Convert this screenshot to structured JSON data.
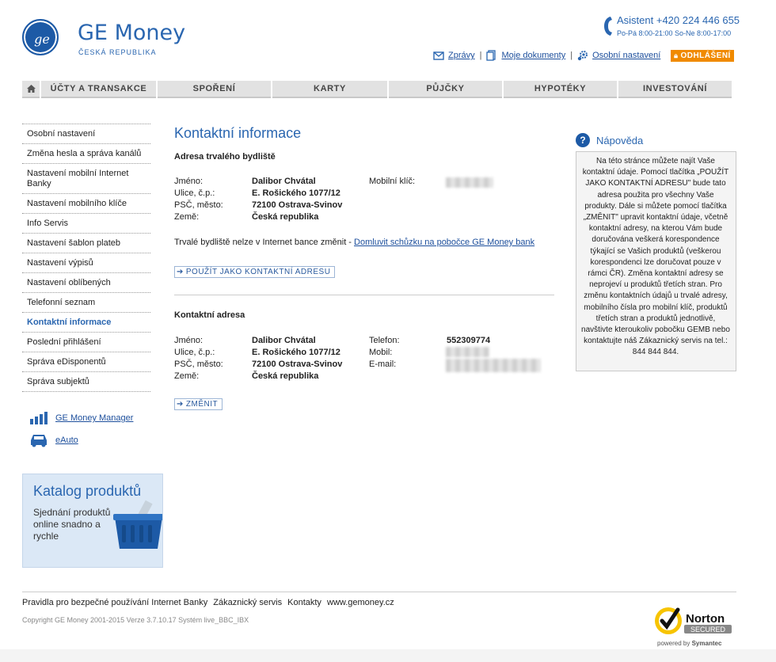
{
  "brand": {
    "title": "GE Money",
    "subtitle": "ČESKÁ REPUBLIKA"
  },
  "assistant": {
    "label": "Asistent +420 224 446 655",
    "hours": "Po-Pá 8:00-21:00 So-Ne 8:00-17:00"
  },
  "top_links": {
    "messages": "Zprávy",
    "documents": "Moje dokumenty",
    "settings": "Osobní nastavení",
    "logout": "ODHLÁŠENÍ"
  },
  "nav": [
    "ÚČTY A TRANSAKCE",
    "SPOŘENÍ",
    "KARTY",
    "PŮJČKY",
    "HYPOTÉKY",
    "INVESTOVÁNÍ"
  ],
  "sidebar": {
    "items": [
      "Osobní nastavení",
      "Změna hesla a správa kanálů",
      "Nastavení mobilní Internet Banky",
      "Nastavení mobilního klíče",
      "Info Servis",
      "Nastavení šablon plateb",
      "Nastavení výpisů",
      "Nastavení oblíbených",
      "Telefonní seznam",
      "Kontaktní informace",
      "Poslední přihlášení",
      "Správa eDisponentů",
      "Správa subjektů"
    ],
    "tools": [
      "GE Money Manager",
      "eAuto"
    ],
    "katalog": {
      "title": "Katalog produktů",
      "desc": "Sjednání produktů online snadno a rychle"
    }
  },
  "main": {
    "title": "Kontaktní informace",
    "permanent": {
      "heading": "Adresa trvalého bydliště",
      "labels": [
        "Jméno:",
        "Ulice, č.p.:",
        "PSČ, město:",
        "Země:"
      ],
      "values": [
        "Dalibor Chvátal",
        "E. Rošického 1077/12",
        "72100 Ostrava-Svinov",
        "Česká republika"
      ],
      "mobile_key_label": "Mobilní klíč:",
      "note": "Trvalé bydliště nelze v Internet bance změnit - ",
      "note_link": "Domluvit schůzku na pobočce GE Money bank",
      "use_button": "POUŽÍT JAKO KONTAKTNÍ ADRESU"
    },
    "contact": {
      "heading": "Kontaktní adresa",
      "labels": [
        "Jméno:",
        "Ulice, č.p.:",
        "PSČ, město:",
        "Země:"
      ],
      "values": [
        "Dalibor  Chvátal",
        "E. Rošického 1077/12",
        "72100 Ostrava-Svinov",
        "Česká republika"
      ],
      "right_labels": [
        "Telefon:",
        "Mobil:",
        "E-mail:"
      ],
      "phone": "552309774",
      "change_button": "ZMĚNIT"
    }
  },
  "help": {
    "title": "Nápověda",
    "text": "Na této stránce můžete najít Vaše kontaktní údaje. Pomocí tlačítka „POUŽÍT JAKO KONTAKTNÍ ADRESU\" bude tato adresa použita pro všechny Vaše produkty. Dále si můžete pomocí tlačítka „ZMĚNIT\" upravit kontaktní údaje, včetně kontaktní adresy, na kterou Vám bude doručována veškerá korespondence týkající se Vašich produktů (veškerou korespondenci lze doručovat pouze v rámci ČR). Změna kontaktní adresy se neprojeví u produktů třetích stran. Pro změnu kontaktních údajů u trvalé adresy, mobilního čísla pro mobilní klíč, produktů třetích stran a produktů jednotlivě, navštivte kteroukoliv pobočku GEMB nebo kontaktujte náš Zákaznický servis na tel.: 844 844 844."
  },
  "footer": {
    "links": [
      "Pravidla pro bezpečné používání Internet Banky",
      "Zákaznický servis",
      "Kontakty",
      "www.gemoney.cz"
    ],
    "copyright": "Copyright GE Money 2001-2015   Verze 3.7.10.17   Systém live_BBC_IBX",
    "norton": {
      "name": "Norton",
      "secured": "SECURED",
      "powered": "powered by",
      "brand": "Symantec"
    }
  },
  "colors": {
    "brand_blue": "#2a66b0",
    "logout_orange": "#f08a00",
    "norton_yellow": "#f7c400"
  }
}
